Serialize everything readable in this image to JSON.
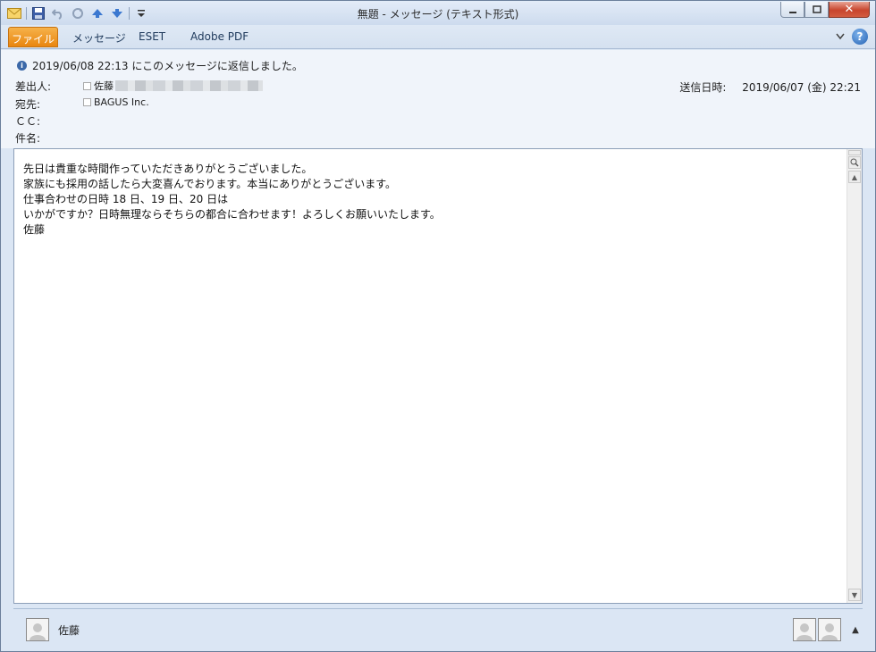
{
  "window": {
    "title": "無題 - メッセージ (テキスト形式)"
  },
  "ribbon": {
    "tabs": [
      {
        "label": "ファイル"
      },
      {
        "label": "メッセージ"
      },
      {
        "label": "ESET"
      },
      {
        "label": "Adobe PDF"
      }
    ],
    "help_label": "?"
  },
  "header": {
    "info_text": "2019/06/08 22:13 にこのメッセージに返信しました。",
    "from_label": "差出人:",
    "from_value": "佐藤",
    "to_label": "宛先:",
    "to_value": "BAGUS Inc.",
    "cc_label": "ＣＣ:",
    "subject_label": "件名:",
    "sent_label": "送信日時:",
    "sent_value": "2019/06/07 (金) 22:21"
  },
  "message": {
    "body": "先日は貴重な時間作っていただきありがとうございました。\n家族にも採用の話したら大変喜んでおります。本当にありがとうございます。\n仕事合わせの日時 18 日、19 日、20 日は\nいかがですか？日時無理ならそちらの都合に合わせます！よろしくお願いいたします。\n佐藤"
  },
  "people_pane": {
    "name": "佐藤",
    "collapse_glyph": "▲"
  },
  "icons": [
    "mail-icon",
    "save-icon",
    "undo-icon",
    "redo-icon",
    "previous-item-icon",
    "next-item-icon",
    "customize-qat-icon",
    "minimize-icon",
    "maximize-icon",
    "close-icon",
    "ribbon-collapse-icon",
    "help-icon",
    "info-icon",
    "person-icon"
  ]
}
